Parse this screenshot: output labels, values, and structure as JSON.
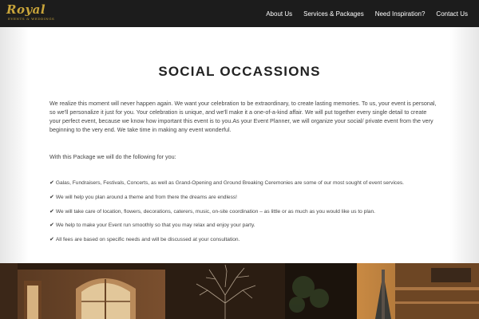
{
  "nav": {
    "logo_text": "Royal",
    "logo_subtitle": "EVENTS & WEDDINGS",
    "links": [
      "About Us",
      "Services & Packages",
      "Need Inspiration?",
      "Contact Us"
    ]
  },
  "main": {
    "title": "SOCIAL OCCASSIONS",
    "intro": "We realize this moment will never happen again. We want your celebration to be extraordinary, to create lasting memories. To us, your event is personal, so we'll personalize it just for you. Your celebration is unique, and we'll make it a one-of-a-kind affair. We will put together every single detail to create your perfect event, because we know how important this event is to you.As your Event Planner, we will organize your social/ private event from the very beginning to the very end. We take time in making any event wonderful.",
    "package_intro": "With this Package we will do the following for you:",
    "check_glyph": "✔",
    "items": [
      "Galas, Fundraisers, Festivals, Concerts, as well as Grand-Opening and Ground Breaking Ceremonies are some of our most sought of event services.",
      "We will help you plan around a theme and from there the dreams are endless!",
      "We will take care of location, flowers, decorations, caterers, music, on-site coordination – as little or as much as you would like us to plan.",
      "We help to make your Event run smoothly so that you may relax and enjoy your party.",
      "All fees are based on specific needs and will be discussed at your consultation."
    ]
  },
  "colors": {
    "nav_bg": "#1c1c1c",
    "logo_gold": "#c9a53a",
    "text": "#444444"
  },
  "icons": [
    "checkmark-icon"
  ]
}
